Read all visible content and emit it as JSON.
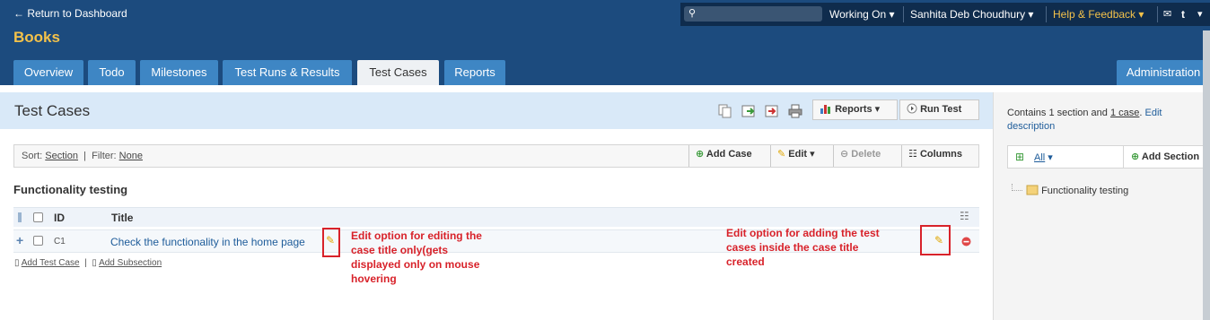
{
  "header": {
    "back_link": "← Return to Dashboard",
    "project": "Books",
    "working_on": "Working On",
    "user": "Sanhita Deb Choudhury",
    "help": "Help & Feedback",
    "search_placeholder": ""
  },
  "tabs": [
    "Overview",
    "Todo",
    "Milestones",
    "Test Runs & Results",
    "Test Cases",
    "Reports",
    "Administration"
  ],
  "page": {
    "title": "Test Cases",
    "reports_btn": "Reports",
    "run_test_btn": "Run Test"
  },
  "filterbar": {
    "sort_label": "Sort:",
    "sort_value": "Section",
    "filter_label": "Filter:",
    "filter_value": "None",
    "add_case": "Add Case",
    "edit": "Edit",
    "delete": "Delete",
    "columns": "Columns"
  },
  "section": {
    "title": "Functionality testing",
    "col_id": "ID",
    "col_title": "Title",
    "rows": [
      {
        "id": "C1",
        "title": "Check the functionality in the home page"
      }
    ],
    "add_test_case": "Add Test Case",
    "add_subsection": "Add Subsection"
  },
  "annotations": {
    "left_l1": "Edit option for editing the",
    "left_l2": "case title only(gets",
    "left_l3": "displayed only on mouse",
    "left_l4": "hovering",
    "right_l1": "Edit option for adding the test",
    "right_l2": "cases inside the case title",
    "right_l3": "created"
  },
  "sidebar": {
    "desc_prefix": "Contains 1 section and ",
    "desc_case": "1 case",
    "desc_dot": ".",
    "edit_link": "Edit",
    "desc_word": "description",
    "all": "All",
    "add_section": "Add Section",
    "tree_item": "Functionality testing"
  },
  "colors": {
    "header": "#1c4b7e",
    "tab": "#3e86c4",
    "accent": "#f4c24a",
    "annotation": "#d8222a"
  }
}
